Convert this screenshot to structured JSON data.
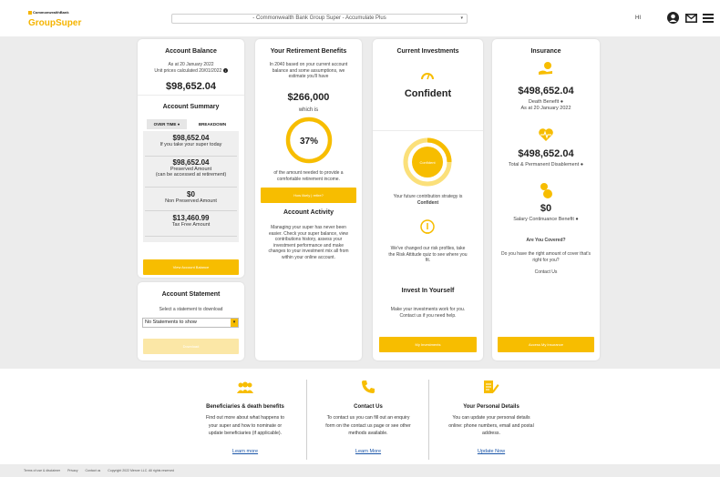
{
  "header": {
    "logo_small": "CommonwealthBank",
    "logo": "GroupSuper",
    "account_select": "- Commonwealth Bank Group Super - Accumulate Plus",
    "greeting": "HI"
  },
  "balance": {
    "title": "Account Balance",
    "as_at": "As at 20 January 2022",
    "unit_prices": "Unit prices calculated 20/01/2022",
    "amount": "$98,652.04"
  },
  "summary": {
    "title": "Account Summary",
    "tab_over_time": "OVER TIME",
    "tab_breakdown": "BREAKDOWN",
    "rows": [
      {
        "value": "$98,652.04",
        "label": "If you take your super today"
      },
      {
        "value": "$98,652.04",
        "label": "Preserved Amount",
        "label2": "(can be accessed at retirement)"
      },
      {
        "value": "$0",
        "label": "Non Preserved Amount"
      },
      {
        "value": "$13,460.99",
        "label": "Tax Free Amount"
      }
    ],
    "button": "View Account Balance"
  },
  "statement": {
    "title": "Account Statement",
    "prompt": "Select a statement to download",
    "select_value": "No Statements to show",
    "button": "Download"
  },
  "retirement": {
    "title": "Your Retirement Benefits",
    "intro": [
      "In 2040 based on your current account",
      "balance and some assumptions, we",
      "estimate you'll have"
    ],
    "amount": "$266,000",
    "which_is": "which is",
    "percent": "37%",
    "percent_value": 0.37,
    "desc": [
      "of the amount needed to provide a",
      "comfortable retirement income."
    ],
    "button": "How likely | retire?"
  },
  "activity": {
    "title": "Account Activity",
    "desc": [
      "Managing your super has never been",
      "easier. Check your super balance, view",
      "contributions history, assess your",
      "investment performance and make",
      "changes to your investment mix all from",
      "within your online account."
    ]
  },
  "investments": {
    "title": "Current Investments",
    "strategy_label": "Confident",
    "ring_label": "Confident",
    "contribution": "Your future contribution strategy is",
    "contribution_value": "Confident",
    "risk": [
      "We've changed our risk profiles, take",
      "the Risk Attitude quiz to see where you",
      "fit."
    ],
    "invest_title": "Invest In Yourself",
    "invest_desc": [
      "Make your investments work for you.",
      "Contact us if you need help."
    ],
    "button": "My Investments"
  },
  "insurance": {
    "title": "Insurance",
    "death_amount": "$498,652.04",
    "death_label": "Death Benefit",
    "death_asat": "As at 20 January 2022",
    "tpd_amount": "$498,652.04",
    "tpd_label": "Total & Permanent Disablement",
    "sc_amount": "$0",
    "sc_label": "Salary Continuance Benefit",
    "covered_q": "Are You Covered?",
    "covered_desc": [
      "Do you have the right amount of cover that's",
      "right for you?"
    ],
    "contact": "Contact Us",
    "button": "Access My Insurance"
  },
  "footer": [
    {
      "title": "Beneficiaries & death benefits",
      "desc": [
        "Find out more about what happens to",
        "your super and how to nominate or",
        "update beneficiaries (if applicable)."
      ],
      "link": "Learn more",
      "icon": "people-icon"
    },
    {
      "title": "Contact Us",
      "desc": [
        "To contact us you can fill out an enquiry",
        "form on the contact us page or see other",
        "methods available."
      ],
      "link": "Learn More",
      "icon": "phone-icon"
    },
    {
      "title": "Your Personal Details",
      "desc": [
        "You can update your personal details",
        "online: phone numbers, email and postal",
        "address."
      ],
      "link": "Update Now",
      "icon": "document-edit-icon"
    }
  ],
  "legal": [
    "Terms of use & disclaimer",
    "Privacy",
    "Contact us",
    "Copyright 2022 Mercer LLC. All rights reserved"
  ],
  "colors": {
    "accent": "#f7bd00",
    "link": "#1a55a8"
  }
}
